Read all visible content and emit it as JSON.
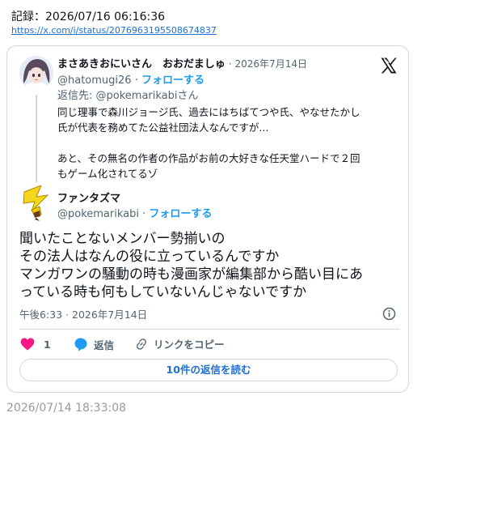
{
  "header": {
    "title": "記録：2026/07/16 06:16:36",
    "link": "https://x.com/i/status/2076963195508674837"
  },
  "parent_tweet": {
    "display_name": "まさあきおにいさん　おおだましゅ",
    "date": "· 2026年7月14日",
    "handle": "@hatomugi26",
    "separator": " · ",
    "follow": "フォローする",
    "reply_to": "返信先: @pokemarikabiさん",
    "text": "同じ理事で森川ジョージ氏、過去にはちばてつや氏、やなせたかし\n氏が代表を務めてた公益社団法人なんですが...\n\nあと、その無名の作者の作品がお前の大好きな任天堂ハードで２回\nもゲーム化されてるゾ"
  },
  "main_tweet": {
    "display_name": "ファンタズマ",
    "handle": "@pokemarikabi",
    "separator": " · ",
    "follow": "フォローする",
    "text": "聞いたことないメンバー勢揃いの\nその法人はなんの役に立っているんですか\nマンガワンの騒動の時も漫画家が編集部から酷い目にあ\nっている時も何もしていないんじゃないですか",
    "timestamp": "午後6:33 · 2026年7月14日"
  },
  "actions": {
    "like_count": "1",
    "reply_label": "返信",
    "copy_link_label": "リンクをコピー"
  },
  "read_replies": "10件の返信を読む",
  "footer_time": "2026/07/14 18:33:08",
  "colors": {
    "link_blue": "#1d9bf0",
    "like_pink": "#f91880",
    "reply_blue": "#1d9bf0",
    "muted": "#536471"
  },
  "icons": [
    "x-logo-icon",
    "info-icon",
    "heart-icon",
    "reply-bubble-icon",
    "link-icon"
  ]
}
